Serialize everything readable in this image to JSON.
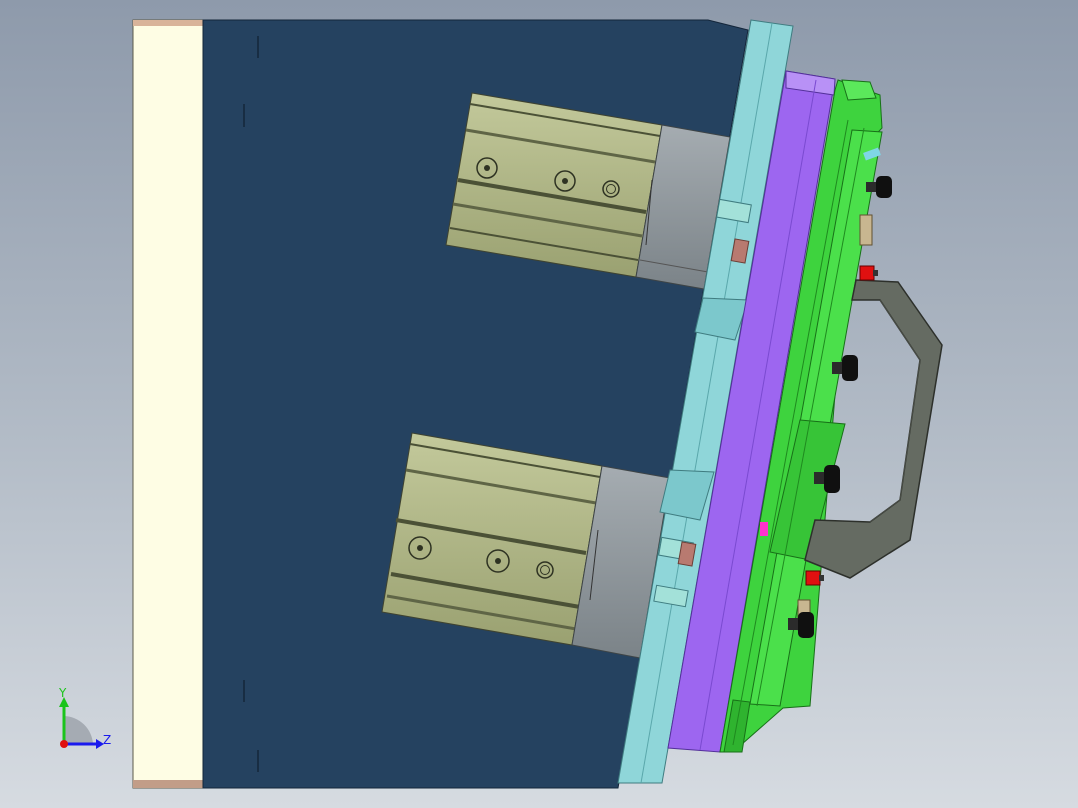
{
  "viewport": {
    "background_top": "#8e9aab",
    "background_bottom": "#d6dbe1"
  },
  "colors": {
    "cream_plate": "#fefde4",
    "dark_body": "#254260",
    "cyan_plate": "#8fd6d9",
    "purple_plate": "#9d66f0",
    "green_fixture": "#3ed33e",
    "cylinder_body": "#aeb585",
    "cylinder_cap": "#8e969c",
    "handle": "#656b62",
    "red_button": "#e01010",
    "black_knob": "#101010"
  },
  "triad": {
    "y_label": "Y",
    "z_label": "Z",
    "y_color": "#1bc41b",
    "z_color": "#1a1aee",
    "origin_color": "#e01010"
  }
}
